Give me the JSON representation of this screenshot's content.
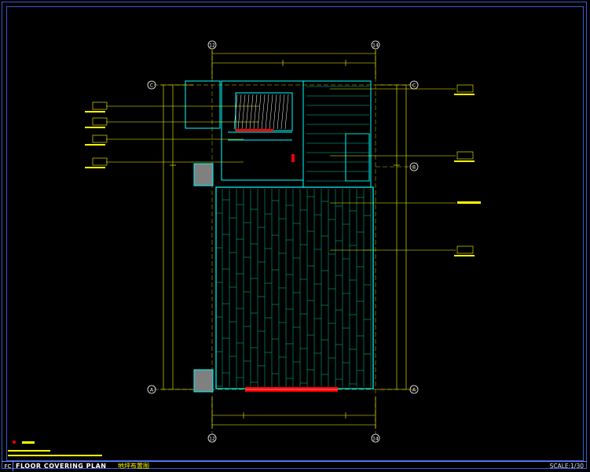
{
  "title_bar": {
    "tag": "FC",
    "title_en": "FLOOR COVERING PLAN",
    "title_cn": "地坪布置图",
    "scale": "SCALE:1/30"
  },
  "axes": {
    "top_left": "12",
    "top_right": "14",
    "bottom_left": "12",
    "bottom_right": "14",
    "left_top": "C",
    "left_bottom": "A",
    "right_top": "C",
    "right_mid": "B",
    "right_bottom": "A"
  },
  "colors": {
    "wall": "#00ffff",
    "floor_line": "#00c8a0",
    "dimension": "#ffff00",
    "leader": "#ffff00",
    "marker": "#ff0000",
    "frame": "#3a5bd0",
    "column_fill": "#808080"
  }
}
